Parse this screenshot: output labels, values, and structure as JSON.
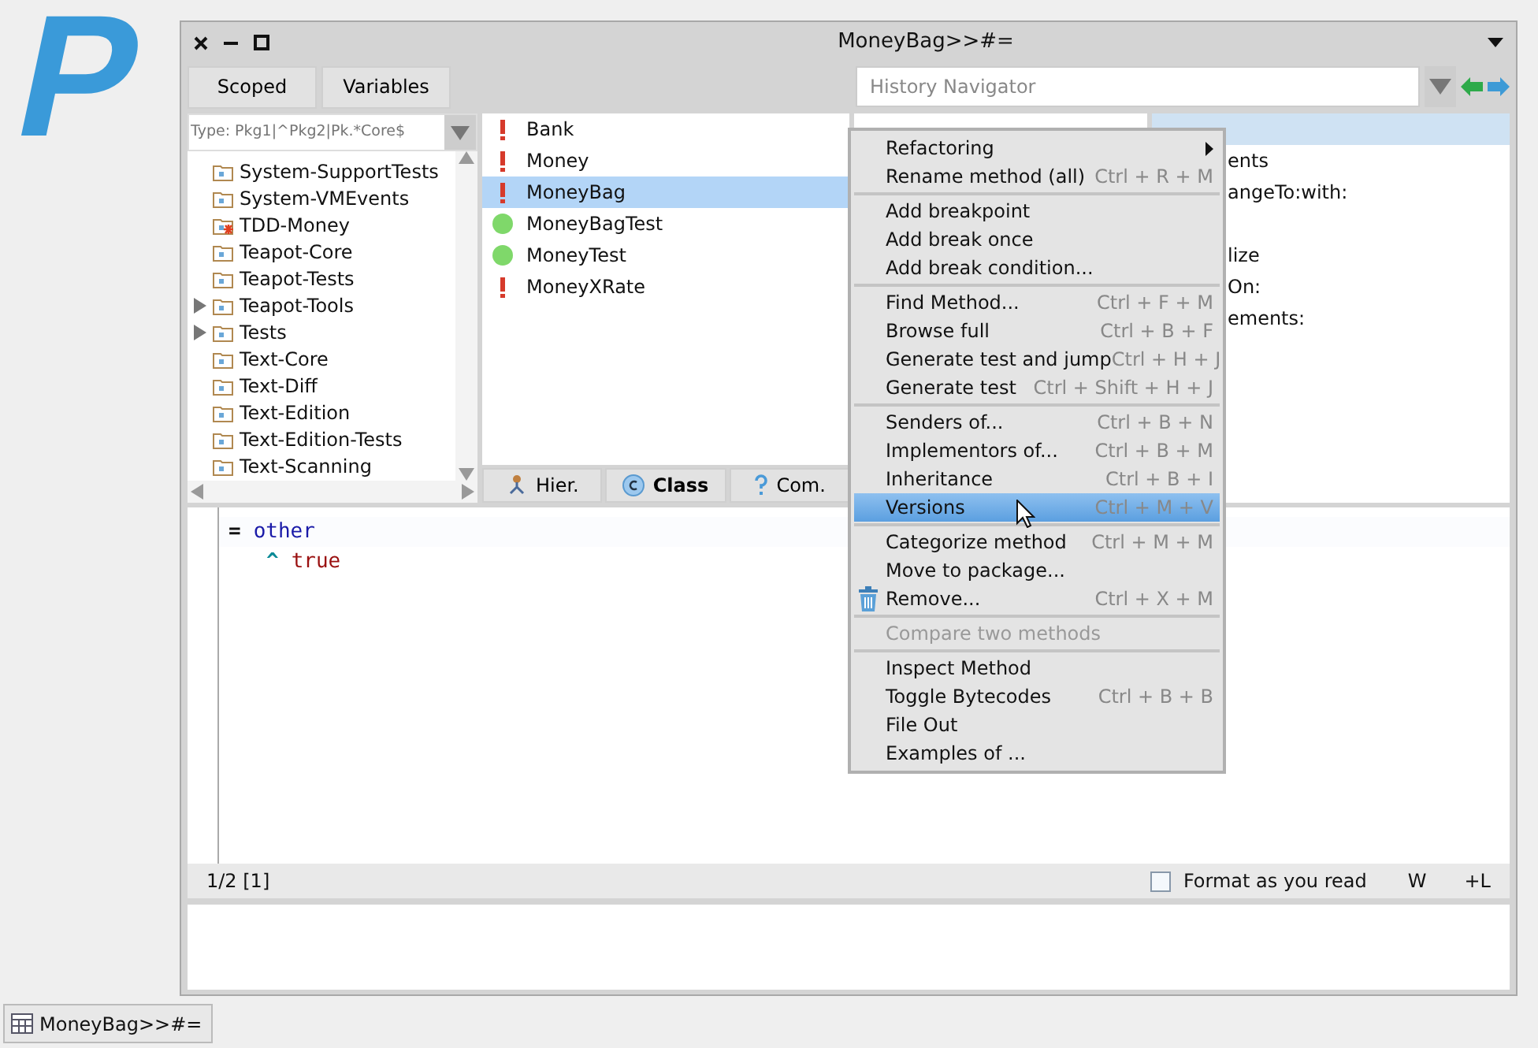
{
  "desktop": {
    "logo_text": "P"
  },
  "window": {
    "title": "MoneyBag>>#="
  },
  "toolbar": {
    "buttons": [
      {
        "label": "Scoped"
      },
      {
        "label": "Variables"
      }
    ],
    "history": {
      "placeholder": "History Navigator"
    }
  },
  "package_filter": {
    "placeholder": "Type: Pkg1|^Pkg2|Pk.*Core$"
  },
  "packages": [
    {
      "label": "System-SupportTests",
      "kind": "plain",
      "expandable": false
    },
    {
      "label": "System-VMEvents",
      "kind": "plain",
      "expandable": false
    },
    {
      "label": "TDD-Money",
      "kind": "flagged",
      "expandable": false
    },
    {
      "label": "Teapot-Core",
      "kind": "plain",
      "expandable": false
    },
    {
      "label": "Teapot-Tests",
      "kind": "plain",
      "expandable": false
    },
    {
      "label": "Teapot-Tools",
      "kind": "plain",
      "expandable": true
    },
    {
      "label": "Tests",
      "kind": "plain",
      "expandable": true
    },
    {
      "label": "Text-Core",
      "kind": "plain",
      "expandable": false
    },
    {
      "label": "Text-Diff",
      "kind": "plain",
      "expandable": false
    },
    {
      "label": "Text-Edition",
      "kind": "plain",
      "expandable": false
    },
    {
      "label": "Text-Edition-Tests",
      "kind": "plain",
      "expandable": false
    },
    {
      "label": "Text-Scanning",
      "kind": "plain",
      "expandable": false
    }
  ],
  "classes": [
    {
      "label": "Bank",
      "kind": "error",
      "selected": false
    },
    {
      "label": "Money",
      "kind": "error",
      "selected": false
    },
    {
      "label": "MoneyBag",
      "kind": "error",
      "selected": true
    },
    {
      "label": "MoneyBagTest",
      "kind": "passed",
      "selected": false
    },
    {
      "label": "MoneyTest",
      "kind": "passed",
      "selected": false
    },
    {
      "label": "MoneyXRate",
      "kind": "error",
      "selected": false
    }
  ],
  "class_buttons": [
    {
      "kind": "hierarchy",
      "label": "Hier.",
      "selected": false
    },
    {
      "kind": "class",
      "label": "Class",
      "selected": true
    },
    {
      "kind": "comment",
      "label": "Com.",
      "selected": false
    }
  ],
  "methods": [
    {
      "selected": true
    },
    {
      "text": "ents",
      "selected": false
    },
    {
      "text": "angeTo:with:",
      "selected": false
    },
    {
      "selected": false
    },
    {
      "text": "lize",
      "selected": false
    },
    {
      "text": "On:",
      "selected": false
    },
    {
      "text": "ements:",
      "selected": false
    }
  ],
  "code": [
    {
      "indented": false,
      "tokens": [
        {
          "kind": "selector",
          "text": "="
        },
        {
          "kind": "argument",
          "text": "other"
        }
      ]
    },
    {
      "indented": true,
      "tokens": [
        {
          "kind": "return",
          "text": "^"
        },
        {
          "kind": "literal",
          "text": "true"
        }
      ]
    }
  ],
  "status_bar": {
    "position": "1/2 [1]",
    "format_checkbox": {
      "label": "Format as you read",
      "checked": false
    },
    "wrap": "W",
    "lines": "+L"
  },
  "context_menu": {
    "groups": [
      [
        {
          "label": "Refactoring",
          "submenu": true,
          "highlighted": false,
          "disabled": false
        },
        {
          "label": "Rename method (all)",
          "shortcut": "Ctrl + R + M",
          "highlighted": false,
          "disabled": false
        }
      ],
      [
        {
          "label": "Add breakpoint",
          "highlighted": false,
          "disabled": false
        },
        {
          "label": "Add break once",
          "highlighted": false,
          "disabled": false
        },
        {
          "label": "Add break condition...",
          "highlighted": false,
          "disabled": false
        }
      ],
      [
        {
          "label": "Find Method...",
          "shortcut": "Ctrl + F + M",
          "highlighted": false,
          "disabled": false
        },
        {
          "label": "Browse full",
          "shortcut": "Ctrl + B + F",
          "highlighted": false,
          "disabled": false
        },
        {
          "label": "Generate test and jump",
          "shortcut": "Ctrl + H + J",
          "highlighted": false,
          "disabled": false
        },
        {
          "label": "Generate test",
          "shortcut": "Ctrl + Shift + H + J",
          "highlighted": false,
          "disabled": false
        }
      ],
      [
        {
          "label": "Senders of...",
          "shortcut": "Ctrl + B + N",
          "highlighted": false,
          "disabled": false
        },
        {
          "label": "Implementors of...",
          "shortcut": "Ctrl + B + M",
          "highlighted": false,
          "disabled": false
        },
        {
          "label": "Inheritance",
          "shortcut": "Ctrl + B + I",
          "highlighted": false,
          "disabled": false
        },
        {
          "label": "Versions",
          "shortcut": "Ctrl + M + V",
          "highlighted": true,
          "disabled": false
        }
      ],
      [
        {
          "label": "Categorize method",
          "shortcut": "Ctrl + M + M",
          "highlighted": false,
          "disabled": false
        },
        {
          "label": "Move to package...",
          "highlighted": false,
          "disabled": false
        },
        {
          "label": "Remove...",
          "shortcut": "Ctrl + X + M",
          "kind": "remove",
          "highlighted": false,
          "disabled": false
        }
      ],
      [
        {
          "label": "Compare two methods",
          "highlighted": false,
          "disabled": true
        }
      ],
      [
        {
          "label": "Inspect Method",
          "highlighted": false,
          "disabled": false
        },
        {
          "label": "Toggle Bytecodes",
          "shortcut": "Ctrl + B + B",
          "highlighted": false,
          "disabled": false
        },
        {
          "label": "File Out",
          "highlighted": false,
          "disabled": false
        },
        {
          "label": "Examples of ...",
          "highlighted": false,
          "disabled": false
        }
      ]
    ]
  },
  "taskbar": [
    {
      "label": "MoneyBag>>#="
    }
  ]
}
